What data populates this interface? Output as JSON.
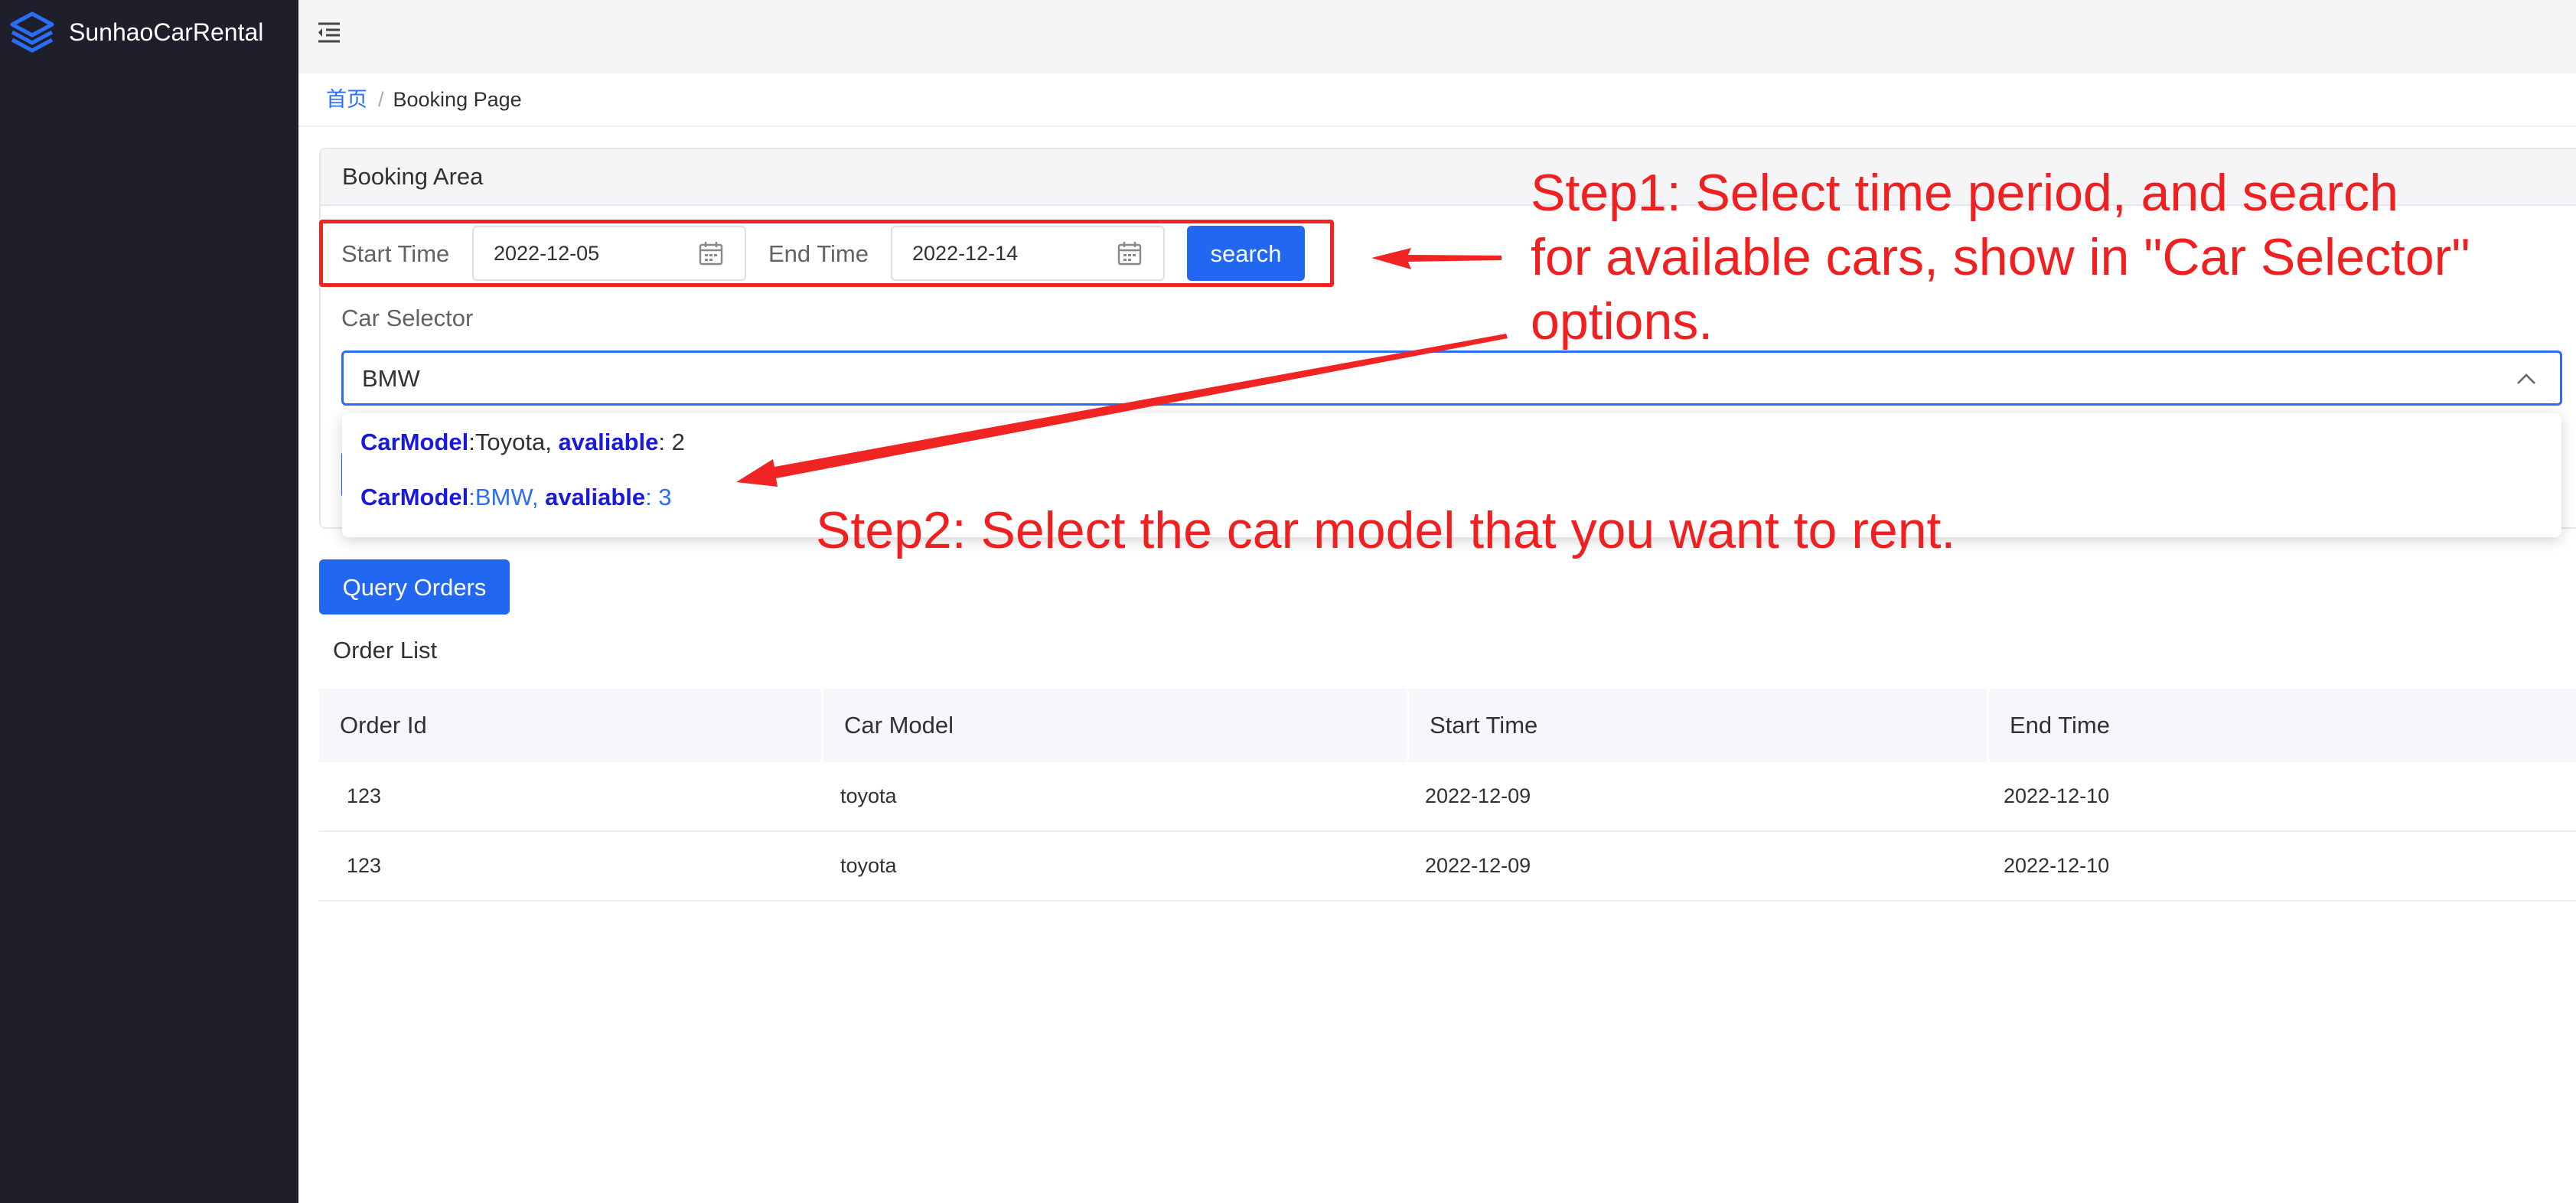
{
  "app": {
    "title": "SunhaoCarRental"
  },
  "icons": {
    "logo": "layers-logo-icon",
    "collapse": "menu-fold-icon",
    "calendar": "calendar-icon",
    "chevron": "chevron-up-icon"
  },
  "colors": {
    "primary": "#2167f2",
    "sidebar": "#1f1f2b",
    "annotation": "#f02020",
    "keyword": "#1a1adb"
  },
  "breadcrumb": {
    "home": "首页",
    "separator": "/",
    "current": "Booking Page"
  },
  "booking": {
    "title": "Booking Area",
    "start_label": "Start Time",
    "start_value": "2022-12-05",
    "end_label": "End Time",
    "end_value": "2022-12-14",
    "search_label": "search"
  },
  "car_selector": {
    "label": "Car Selector",
    "value": "BMW",
    "options": [
      {
        "key1": "CarModel",
        "model": ":Toyota, ",
        "key2": "avaliable",
        "count": ": 2"
      },
      {
        "key1": "CarModel",
        "model": ":BMW, ",
        "key2": "avaliable",
        "count": ": 3"
      }
    ]
  },
  "orders": {
    "query_label": "Query Orders",
    "list_title": "Order List",
    "columns": [
      "Order Id",
      "Car Model",
      "Start Time",
      "End Time"
    ],
    "rows": [
      [
        "123",
        "toyota",
        "2022-12-09",
        "2022-12-10"
      ],
      [
        "123",
        "toyota",
        "2022-12-09",
        "2022-12-10"
      ]
    ]
  },
  "annotations": {
    "step1": [
      "Step1: Select time period, and search",
      "for available cars, show in \"Car Selector\"",
      "options."
    ],
    "step2": "Step2: Select the car model that you want to rent."
  }
}
